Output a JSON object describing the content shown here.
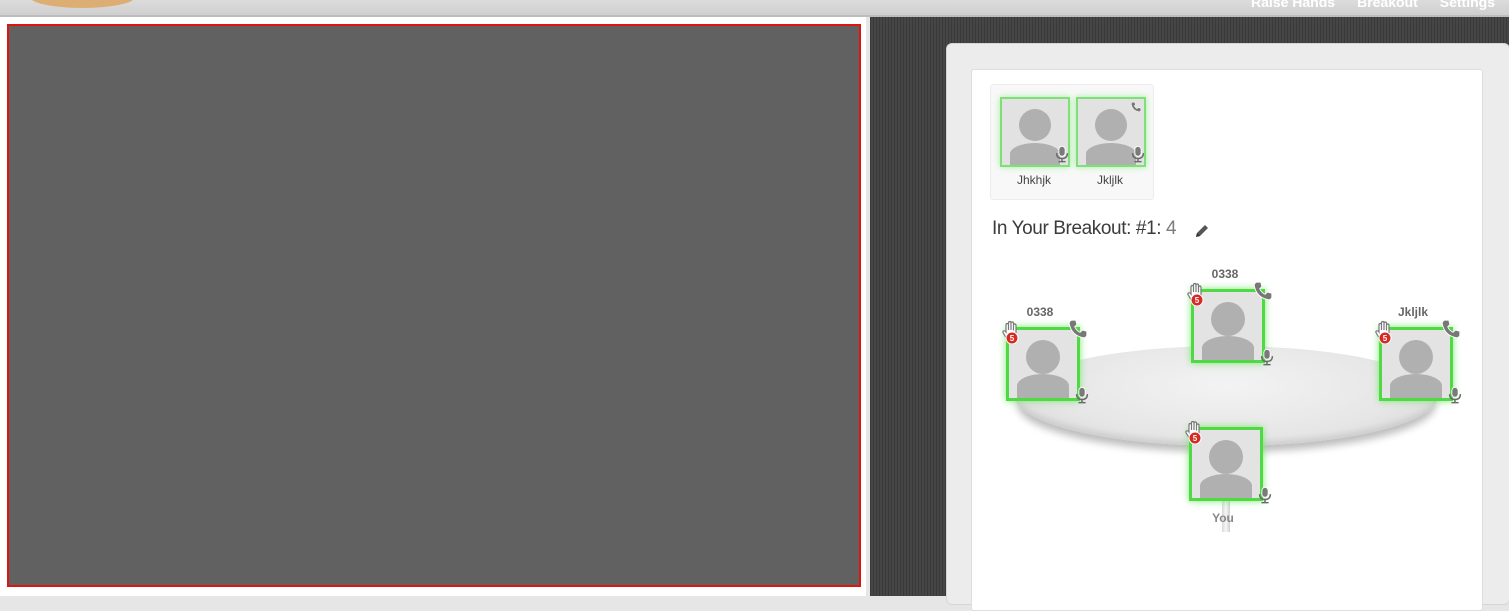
{
  "topnav": {
    "items": [
      "Raise Hands",
      "Breakout",
      "Settings"
    ]
  },
  "colors": {
    "video_border": "#e0140e",
    "active_green": "#4fda43",
    "badge_red": "#d62b24"
  },
  "waiting": {
    "participants": [
      {
        "name": "Jhkhjk",
        "icons": [
          "mic-icon"
        ]
      },
      {
        "name": "Jkljlk",
        "icons": [
          "phone-icon",
          "mic-icon"
        ]
      }
    ]
  },
  "breakout": {
    "label": "In Your Breakout:",
    "room": "#1",
    "separator": ":",
    "count": "4"
  },
  "seats": [
    {
      "name": "0338",
      "hand_count": "5"
    },
    {
      "name": "0338",
      "hand_count": "5"
    },
    {
      "name": "Jkljlk",
      "hand_count": "5"
    },
    {
      "name": "You",
      "hand_count": "5"
    }
  ]
}
